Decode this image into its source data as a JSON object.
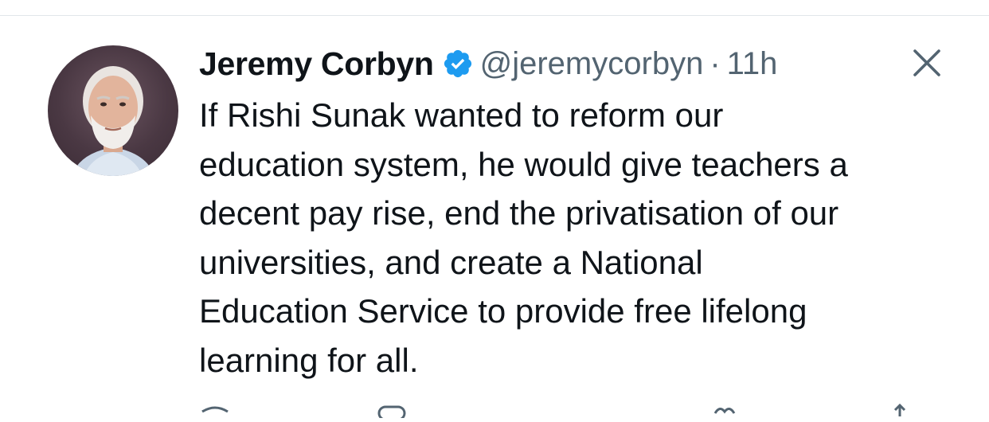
{
  "author": {
    "name": "Jeremy Corbyn",
    "handle": "@jeremycorbyn",
    "separator": "·",
    "time": "11h",
    "verified": true,
    "avatar_icon": "profile-photo"
  },
  "tweet": {
    "lines": [
      "If Rishi Sunak wanted to reform our",
      "education system, he would give teachers a",
      "decent pay rise, end the privatisation of our",
      "universities, and create a National",
      "Education Service to provide free lifelong",
      "learning for all."
    ]
  },
  "icons": {
    "verified": "verified-badge-icon",
    "close": "close-icon",
    "reply": "reply-icon",
    "retweet": "retweet-icon",
    "like": "like-icon",
    "share": "share-icon"
  },
  "colors": {
    "verified_blue": "#1d9bf0",
    "text_primary": "#0f1419",
    "text_secondary": "#536471"
  }
}
